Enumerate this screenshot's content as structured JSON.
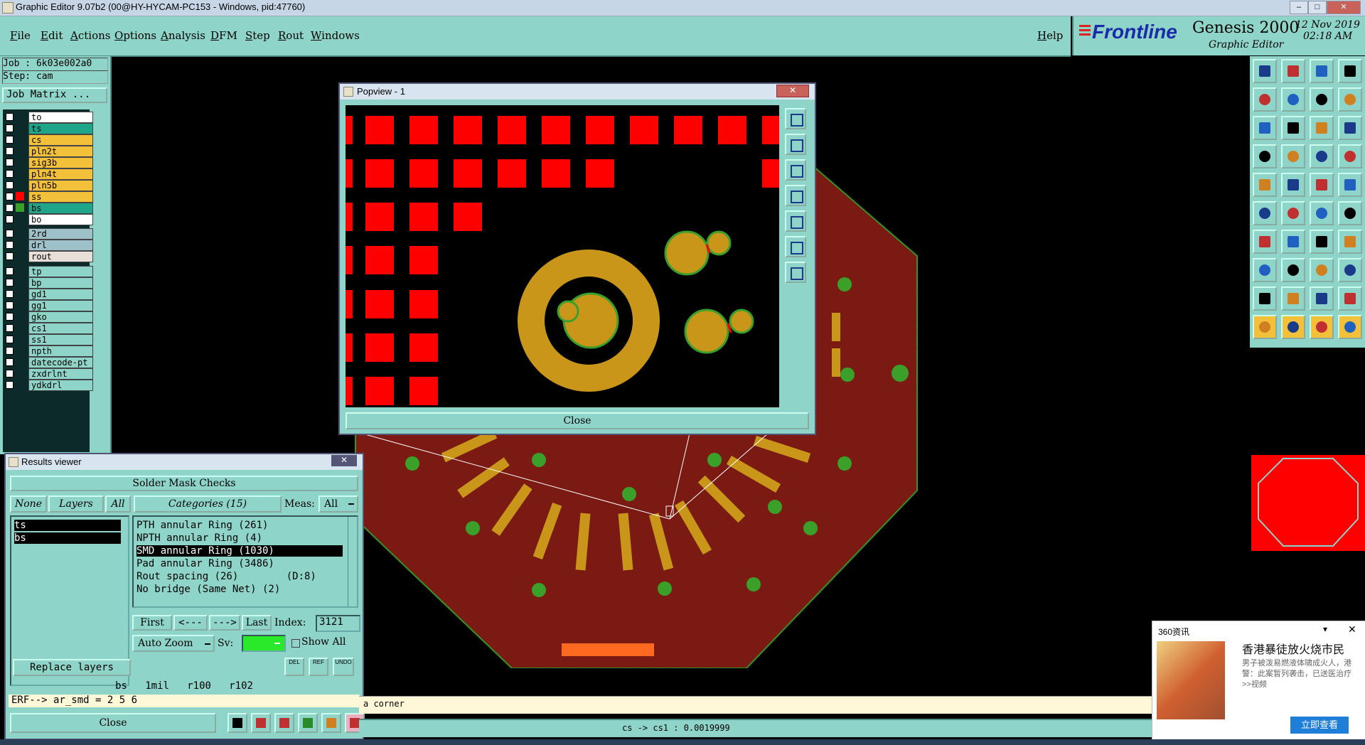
{
  "window": {
    "title": "Graphic Editor 9.07b2 (00@HY-HYCAM-PC153 - Windows, pid:47760)",
    "minimize": "–",
    "maximize": "□",
    "close": "✕"
  },
  "menubar": {
    "items": [
      "File",
      "Edit",
      "Actions",
      "Options",
      "Analysis",
      "DFM",
      "Step",
      "Rout",
      "Windows"
    ],
    "help": "Help"
  },
  "brand": {
    "logo": "Frontline",
    "product": "Genesis 2000",
    "subtitle": "Graphic Editor",
    "date": "12 Nov 2019",
    "time": "02:18 AM"
  },
  "left_panel": {
    "job": "Job : 6k03e002a0",
    "step": "Step: cam",
    "job_matrix": "Job Matrix ...",
    "layers_group1": [
      {
        "name": "to",
        "color": "#ffffff",
        "swatch": ""
      },
      {
        "name": "ts",
        "color": "#1fa58a",
        "swatch": ""
      },
      {
        "name": "cs",
        "color": "#f3c03a",
        "swatch": ""
      },
      {
        "name": "pln2t",
        "color": "#f3c03a",
        "swatch": ""
      },
      {
        "name": "sig3b",
        "color": "#f3c03a",
        "swatch": ""
      },
      {
        "name": "pln4t",
        "color": "#f3c03a",
        "swatch": ""
      },
      {
        "name": "pln5b",
        "color": "#f3c03a",
        "swatch": ""
      },
      {
        "name": "ss",
        "color": "#f3c03a",
        "swatch": "#ff0000"
      },
      {
        "name": "bs",
        "color": "#1fa58a",
        "swatch": "#3aa02a"
      },
      {
        "name": "bo",
        "color": "#ffffff",
        "swatch": ""
      }
    ],
    "layers_group2": [
      {
        "name": "2rd",
        "color": "#9ec0c8"
      },
      {
        "name": "drl",
        "color": "#9ec0c8"
      },
      {
        "name": "rout",
        "color": "#e8e0d8"
      }
    ],
    "layers_group3": [
      {
        "name": "tp",
        "color": "#8fd4c8"
      },
      {
        "name": "bp",
        "color": "#8fd4c8"
      },
      {
        "name": "gd1",
        "color": "#8fd4c8"
      },
      {
        "name": "gg1",
        "color": "#8fd4c8"
      },
      {
        "name": "gko",
        "color": "#8fd4c8"
      },
      {
        "name": "cs1",
        "color": "#8fd4c8"
      },
      {
        "name": "ss1",
        "color": "#8fd4c8"
      },
      {
        "name": "npth",
        "color": "#8fd4c8"
      },
      {
        "name": "datecode-pt",
        "color": "#8fd4c8"
      },
      {
        "name": "zxdrlnt",
        "color": "#8fd4c8"
      },
      {
        "name": "ydkdrl",
        "color": "#8fd4c8"
      }
    ]
  },
  "popview": {
    "title": "Popview - 1",
    "close": "Close"
  },
  "results": {
    "title": "Results viewer",
    "header": "Solder Mask Checks",
    "none_btn": "None",
    "layers_btn": "Layers",
    "all_btn": "All",
    "categories": "Categories (15)",
    "meas_label": "Meas:",
    "meas_value": "All",
    "layers": [
      "ts",
      "bs"
    ],
    "items": [
      "PTH annular Ring (261)",
      "NPTH annular Ring (4)",
      "SMD annular Ring (1030)",
      "Pad annular Ring (3486)",
      "Rout spacing (26)        (D:8)",
      "No bridge (Same Net) (2)"
    ],
    "first": "First",
    "prev": "<---",
    "next": "--->",
    "last": "Last",
    "index_label": "Index:",
    "index_value": "3121",
    "auto_zoom": "Auto Zoom",
    "sv": "Sv:",
    "show_all": "Show All",
    "replace_layers": "Replace layers",
    "del": "DEL",
    "ref": "REF",
    "undo": "UNDO",
    "info": "bs   1mil   r100   r102",
    "erf": "ERF--> ar_smd = 2 5 6",
    "close": "Close"
  },
  "status": {
    "message": "a corner",
    "measure": "cs -> cs1 : 0.0019999"
  },
  "news": {
    "source": "360资讯",
    "headline": "香港暴徒放火烧市民",
    "body": "男子被泼易燃液体啸成火人，港警：此案暂列袭击，已送医治疗>>视频",
    "button": "立即查看"
  }
}
